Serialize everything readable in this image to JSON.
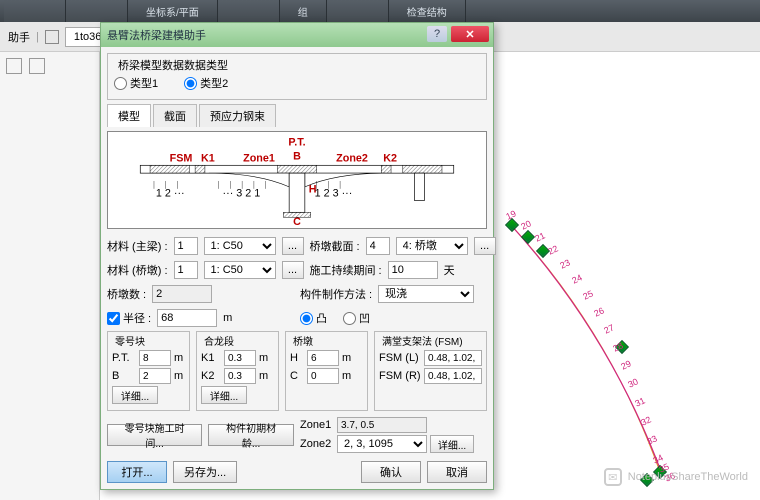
{
  "ribbon": {
    "grp1": "坐标系/平面",
    "grp2": "组",
    "grp3": "检查结构"
  },
  "toolbar": {
    "dropdown": "1to36"
  },
  "dialog": {
    "title": "悬臂法桥梁建模助手",
    "fs1_title": "桥梁模型数据数据类型",
    "type1": "类型1",
    "type2": "类型2",
    "tabs": {
      "t1": "模型",
      "t2": "截面",
      "t3": "预应力钢束"
    },
    "diagram": {
      "pt": "P.T.",
      "fsm": "FSM",
      "k1": "K1",
      "zone1": "Zone1",
      "b": "B",
      "zone2": "Zone2",
      "k2": "K2",
      "h": "H",
      "c": "C"
    },
    "mat_main_lbl": "材料 (主梁) :",
    "mat_main_n": "1",
    "mat_main_v": "1: C50",
    "mat_pier_lbl": "材料 (桥墩) :",
    "mat_pier_n": "1",
    "mat_pier_v": "1: C50",
    "pier_sec_lbl": "桥墩截面 :",
    "pier_sec_n": "4",
    "pier_sec_v": "4: 桥墩",
    "dur_lbl": "施工持续期间 :",
    "dur_v": "10",
    "dur_u": "天",
    "pier_cnt_lbl": "桥墩数 :",
    "pier_cnt_v": "2",
    "method_lbl": "构件制作方法 :",
    "method_v": "现浇",
    "radius_lbl": "半径 :",
    "radius_v": "68",
    "radius_u": "m",
    "convex": "凸",
    "concave": "凹",
    "blk0": {
      "title": "零号块",
      "pt": "P.T.",
      "pt_v": "8",
      "b": "B",
      "b_v": "2",
      "u": "m",
      "detail": "详细..."
    },
    "close": {
      "title": "合龙段",
      "k1": "K1",
      "k1_v": "0.3",
      "k2": "K2",
      "k2_v": "0.3",
      "u": "m",
      "detail": "详细..."
    },
    "pier": {
      "title": "桥墩",
      "h": "H",
      "h_v": "6",
      "c": "C",
      "c_v": "0",
      "u": "m"
    },
    "fsm": {
      "title": "满堂支架法 (FSM)",
      "l": "FSM (L)",
      "l_v": "0.48, 1.02,",
      "r": "FSM (R)",
      "r_v": "0.48, 1.02,"
    },
    "zone1_lbl": "Zone1",
    "zone1_v": "3.7, 0.5",
    "zone2_lbl": "Zone2",
    "zone2_v": "2, 3, 1095",
    "zone_detail": "详细...",
    "btn_time": "零号块施工时间...",
    "btn_mat": "构件初期材龄...",
    "open": "打开...",
    "saveas": "另存为...",
    "ok": "确认",
    "cancel": "取消"
  },
  "curve_nodes": [
    19,
    20,
    21,
    22,
    23,
    24,
    25,
    26,
    27,
    28,
    29,
    30,
    31,
    32,
    33,
    34,
    35,
    36
  ],
  "watermark": "NoteplusShareTheWorld"
}
